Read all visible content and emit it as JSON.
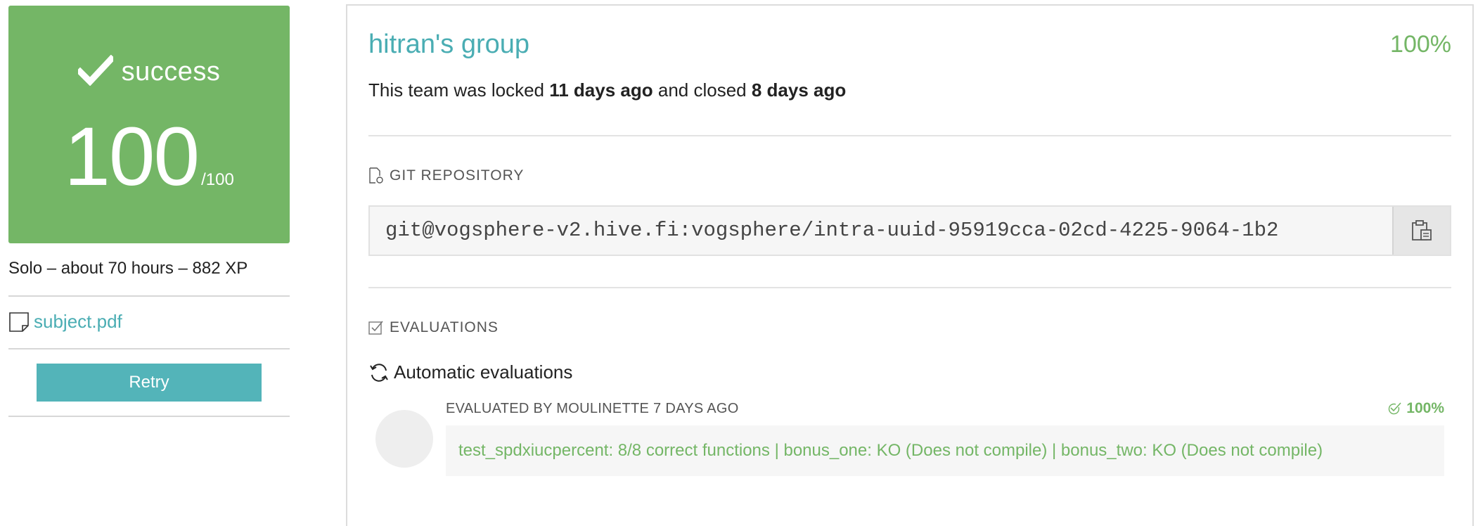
{
  "score_card": {
    "status": "success",
    "score": "100",
    "score_max": "/100",
    "color": "#74b666"
  },
  "project": {
    "meta": "Solo – about 70 hours – 882 XP",
    "subject_link": "subject.pdf",
    "retry_label": "Retry"
  },
  "group": {
    "title": "hitran's group",
    "percent": "100%",
    "team_info": {
      "prefix": "This team was locked ",
      "locked": "11 days ago",
      "middle": " and closed ",
      "closed": "8 days ago"
    }
  },
  "git": {
    "section_label": "GIT REPOSITORY",
    "url": "git@vogsphere-v2.hive.fi:vogsphere/intra-uuid-95919cca-02cd-4225-9064-1b2"
  },
  "evaluations": {
    "section_label": "EVALUATIONS",
    "automatic_label": "Automatic evaluations",
    "items": [
      {
        "evaluated_by": "EVALUATED BY MOULINETTE 7 DAYS AGO",
        "score": "100%",
        "result": "test_spdxiucpercent: 8/8 correct functions | bonus_one: KO (Does not compile) | bonus_two: KO (Does not compile)"
      }
    ]
  },
  "colors": {
    "accent_teal": "#4aadb3",
    "success_green": "#74b666",
    "retry_button": "#53b4b9"
  },
  "icons": [
    "check-icon",
    "document-icon",
    "git-file-icon",
    "clipboard-icon",
    "checkbox-icon",
    "refresh-icon",
    "check-circle-icon"
  ]
}
